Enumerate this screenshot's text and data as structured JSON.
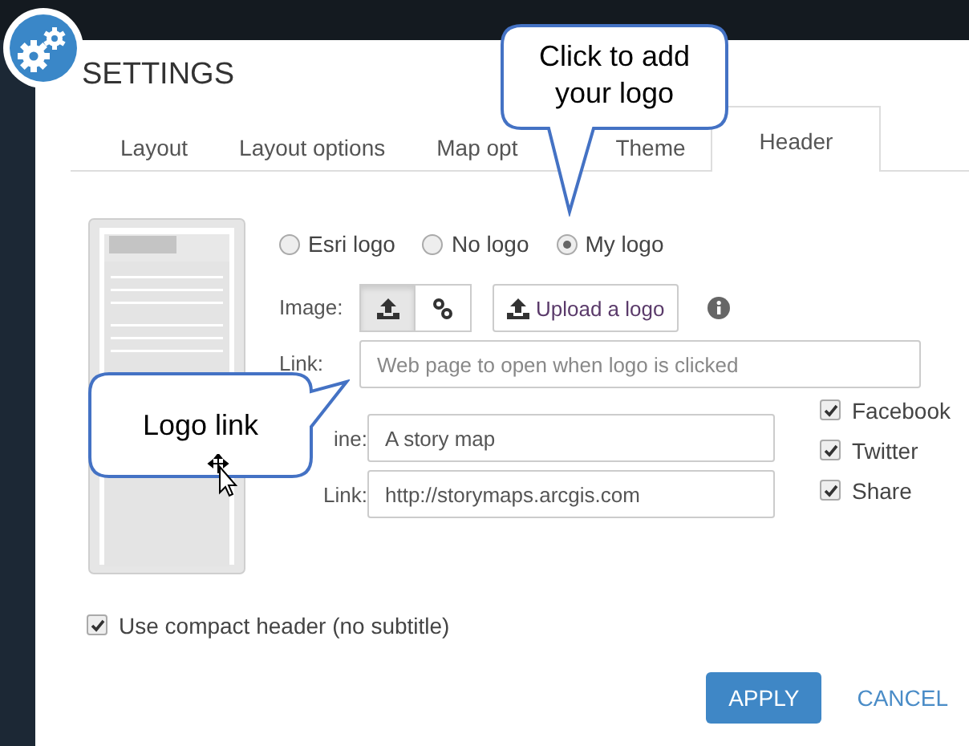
{
  "dialog": {
    "title": "SETTINGS"
  },
  "tabs": [
    {
      "label": "Layout",
      "selected": false
    },
    {
      "label": "Layout options",
      "selected": false
    },
    {
      "label": "Map opt",
      "selected": false
    },
    {
      "label": "Theme",
      "selected": false
    },
    {
      "label": "Header",
      "selected": true
    }
  ],
  "logo_options": [
    {
      "label": "Esri logo",
      "selected": false
    },
    {
      "label": "No logo",
      "selected": false
    },
    {
      "label": "My logo",
      "selected": true
    }
  ],
  "image": {
    "label": "Image:",
    "modes": [
      {
        "kind": "upload",
        "selected": true
      },
      {
        "kind": "link",
        "selected": false
      }
    ],
    "upload_button": "Upload a logo"
  },
  "logo_link": {
    "label": "Link:",
    "placeholder": "Web page to open when logo is clicked"
  },
  "tagline": {
    "label": "ine:",
    "value": "A story map"
  },
  "tagline_link": {
    "label": "Link:",
    "value": "http://storymaps.arcgis.com"
  },
  "share_options": [
    {
      "label": "Facebook",
      "checked": true
    },
    {
      "label": "Twitter",
      "checked": true
    },
    {
      "label": "Share",
      "checked": true
    }
  ],
  "compact_header": {
    "label": "Use compact header (no subtitle)",
    "checked": true
  },
  "buttons": {
    "apply": "APPLY",
    "cancel": "CANCEL"
  },
  "callouts": [
    {
      "text": "Click to add your logo"
    },
    {
      "text": "Logo link"
    }
  ]
}
